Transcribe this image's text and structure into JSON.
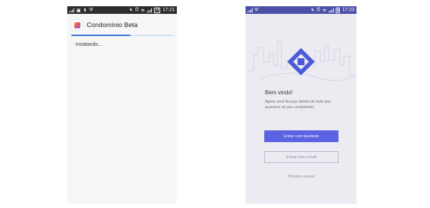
{
  "left_phone": {
    "status_bar": {
      "time": "17:21",
      "battery": "24"
    },
    "header": {
      "title": "Condomínio Beta",
      "icon": "app-icon"
    },
    "progress": {
      "fraction": 0.58
    },
    "status_text": "Instalando..."
  },
  "right_phone": {
    "status_bar": {
      "time": "17:23"
    },
    "welcome_title": "Bem vindo!",
    "description": "Agora você fica por dentro de tudo que acontece no seu condomínio.",
    "facebook_button": "Entrar com facebook",
    "email_button": "Entrar com e-mail",
    "first_access_link": "Primeiro acesso",
    "colors": {
      "status_bar": "#4c4fa8",
      "primary": "#5b63e3",
      "background": "#ecebf2"
    }
  }
}
